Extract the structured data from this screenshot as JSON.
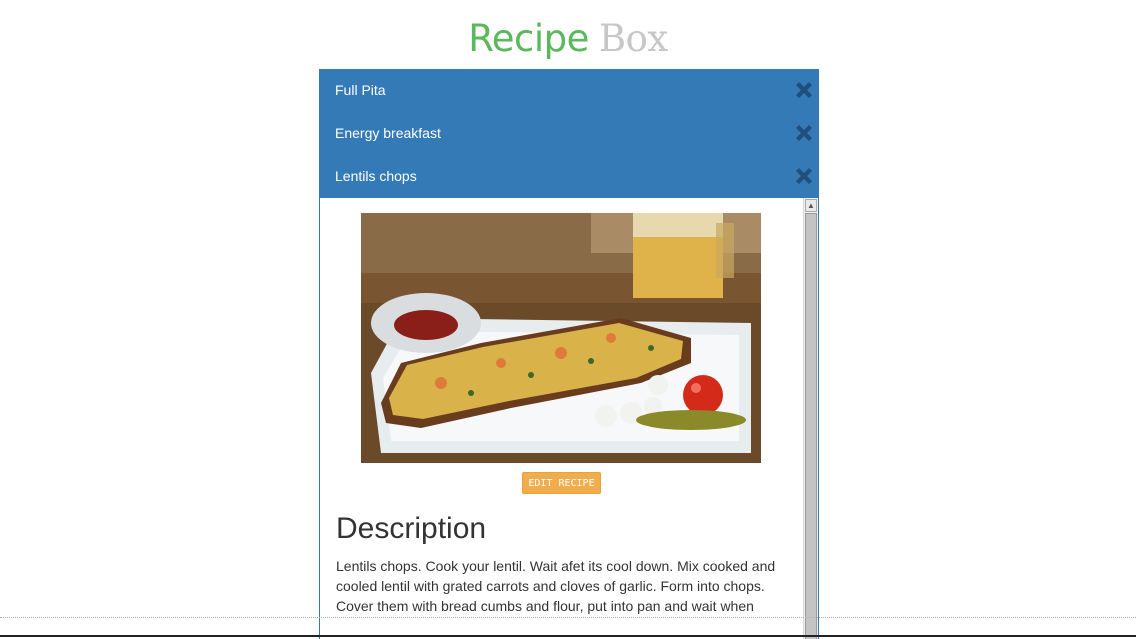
{
  "header": {
    "title_part1": "Recipe",
    "title_part2": "Box"
  },
  "recipes": [
    {
      "name": "Full Pita",
      "delete_icon": "close-icon"
    },
    {
      "name": "Energy breakfast",
      "delete_icon": "close-icon"
    },
    {
      "name": "Lentils chops",
      "delete_icon": "close-icon"
    }
  ],
  "selected_recipe": {
    "edit_label": "EDIT RECIPE",
    "description_heading": "Description",
    "description_text": "Lentils chops. Cook your lentil. Wait afet its cool down. Mix cooked and cooled lentil with grated carrots and cloves of garlic. Form into chops. Cover them with bread cumbs and flour, put into pan and wait when"
  },
  "colors": {
    "accent": "#337ab7",
    "title_green": "#5cb85c",
    "title_gray": "#c7c7c7",
    "edit_button": "#f0ad4e",
    "delete_icon": "#1f4f7a"
  }
}
